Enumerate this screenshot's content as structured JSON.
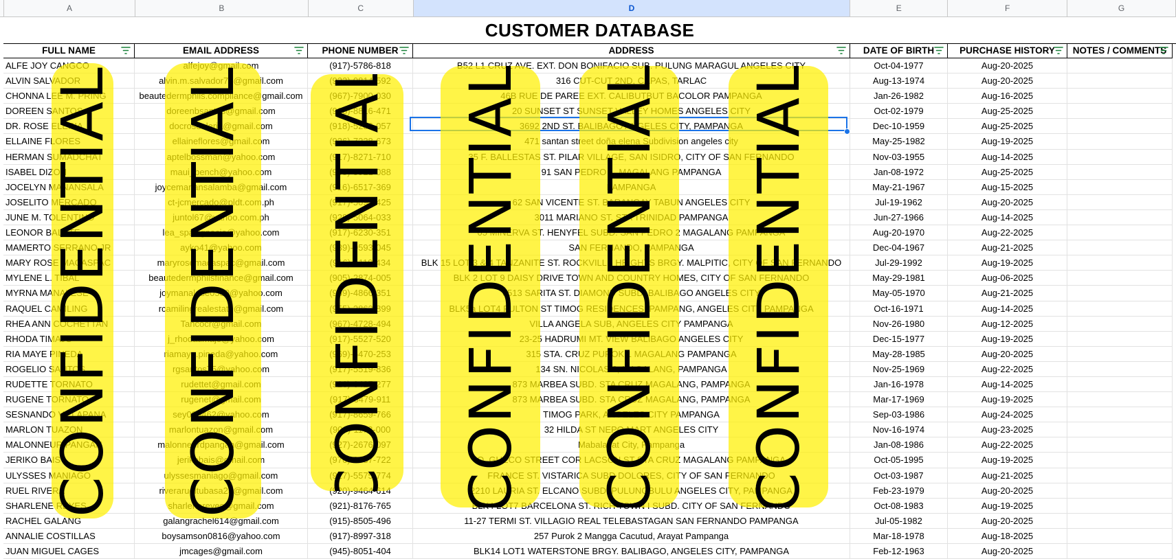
{
  "sheet": {
    "column_letters": [
      "A",
      "B",
      "C",
      "D",
      "E",
      "F",
      "G"
    ],
    "selected_column": "D",
    "title": "CUSTOMER DATABASE",
    "headers": [
      "FULL NAME",
      "EMAIL ADDRESS",
      "PHONE NUMBER",
      "ADDRESS",
      "DATE OF BIRTH",
      "PURCHASE HISTORY",
      "NOTES / COMMENTS"
    ],
    "filter_icon": "filter-icon",
    "rows": [
      [
        "ALFE JOY CANGCO",
        "alfejoy@gmail.com",
        "(917)-5786-818",
        "B52 L1 CRUZ AVE. EXT. DON BONIFACIO SUB. PULUNG MARAGUL ANGELES CITY",
        "Oct-04-1977",
        "Aug-20-2025",
        ""
      ],
      [
        "ALVIN SALVADOR",
        "alvin.m.salvador74@gmail.com",
        "(923)-0814-592",
        "316 CUT-CUT 2ND, CAPAS, TARLAC",
        "Aug-13-1974",
        "Aug-20-2025",
        ""
      ],
      [
        "CHONNA LEE M. PRING",
        "beautedermphils.compliance@gmail.com",
        "(967)-7900-030",
        "46B RUE DE PAREE EXT. CALIBUTBUT BACOLOR PAMPANGA",
        "Jan-26-1982",
        "Aug-16-2025",
        ""
      ],
      [
        "DOREEN SANTOS",
        "doreenbsantos@gmail.com",
        "(968)-8816-471",
        "20 SUNSET ST SUNSET VALLEY HOMES ANGELES CITY",
        "Oct-02-1979",
        "Aug-25-2025",
        ""
      ],
      [
        "DR. ROSE ELERIA",
        "docroseeleria@gmail.com",
        "(918)-5286-057",
        "3692 2ND ST. BALIBAGO ANGELES CITY, PAMPANGA",
        "Dec-10-1959",
        "Aug-25-2025",
        ""
      ],
      [
        "ELLAINE FLORES",
        "ellaineflores@gmail.com",
        "(926)-7238-673",
        "471 santan street doña elena Subdivision angeles city",
        "May-25-1982",
        "Aug-19-2025",
        ""
      ],
      [
        "HERMAN SUMADCHAT",
        "aptelbossman@yahoo.com",
        "(917)-8271-710",
        "35 F. BALLESTAS ST. PILAR VILLAGE, SAN ISIDRO, CITY OF SAN FERNANDO",
        "Nov-03-1955",
        "Aug-14-2025",
        ""
      ],
      [
        "ISABEL DIZON",
        "maui_bench@yahoo.com",
        "(905)-5921-088",
        "91 SAN PEDRO 1, MAGALANG PAMPANGA",
        "Jan-08-1972",
        "Aug-25-2025",
        ""
      ],
      [
        "JOCELYN MANANSALA",
        "joycemanansalamba@gmail.com",
        "(916)-6517-369",
        "PAMPANGA",
        "May-21-1967",
        "Aug-15-2025",
        ""
      ],
      [
        "JOSELITO MERCADO",
        "ct-jcmercado@pldt.com.ph",
        "(917)-5094-425",
        "62 SAN VICENTE ST. BARANGAY TABUN ANGELES CITY",
        "Jul-19-1962",
        "Aug-20-2025",
        ""
      ],
      [
        "JUNE M. TOLENTINO",
        "juntol67@yahoo.com.ph",
        "(928)-5064-033",
        "3011 MARIANO ST. STA TRINIDAD PAMPANGA",
        "Jun-27-1966",
        "Aug-14-2025",
        ""
      ],
      [
        "LEONOR BALETE",
        "lea_spasignacio@yahoo.com",
        "(917)-6230-351",
        "05 MINERVA ST. HENYFEL SUBD. SAN PEDRO 2 MAGALANG PAMPANGA",
        "Aug-20-1970",
        "Aug-22-2025",
        ""
      ],
      [
        "MAMERTO SERRANO JR",
        "ayko41@yahoo.com",
        "(939)-9593-045",
        "SAN FERNANDO, PAMPANGA",
        "Dec-04-1967",
        "Aug-21-2025",
        ""
      ],
      [
        "MARY ROSE MACASPAC",
        "maryrosemacaspac@gmail.com",
        "(916)-4118-434",
        "BLK 15 LOT 3 & 4 TANZANITE ST. ROCKVILLE HEIGHTS BRGY. MALPITIC, CITY OF SAN FERNANDO",
        "Jul-29-1992",
        "Aug-19-2025",
        ""
      ],
      [
        "MYLENE L. TIBAL",
        "beautedermphilsfinance@gmail.com",
        "(905)-2874-005",
        "BLK 2 LOT 9 DAISY DRIVE TOWN AND COUNTRY HOMES, CITY OF SAN FERNANDO",
        "May-29-1981",
        "Aug-06-2025",
        ""
      ],
      [
        "MYRNA MANALESE",
        "joymanalese0580@yahoo.com",
        "(969)-4866-351",
        "6513 SARITA ST. DIAMOND SUBD. BALIBAGO ANGELES CITY",
        "May-05-1970",
        "Aug-21-2025",
        ""
      ],
      [
        "RAQUEL CAMILING",
        "rcamilingrealestate@gmail.com",
        "(955)-3862-899",
        "BLK5a LOT4 FULTON ST TIMOG RESIDENCES, PAMPANG, ANGELES CITY PAMPANGA",
        "Oct-16-1971",
        "Aug-14-2025",
        ""
      ],
      [
        "RHEA ANN COCHETTAN",
        "Tancocr@gmail.com",
        "(967)-4728-494",
        "VILLA ANGELA SUB, ANGELES CITY PAMPANGA",
        "Nov-26-1980",
        "Aug-12-2025",
        ""
      ],
      [
        "RHODA TIMAJO",
        "j_rhodatimajo@yahoo.com",
        "(917)-5527-520",
        "23-25 HADRUMI MT. VIEW BALIBAGO ANGELES CITY",
        "Dec-15-1977",
        "Aug-19-2025",
        ""
      ],
      [
        "RIA MAYE PINEDA",
        "riamaye.pineda@yahoo.com",
        "(969)-6470-253",
        "315 STA. CRUZ PUROK 1 MAGALANG PAMPANGA",
        "May-28-1985",
        "Aug-20-2025",
        ""
      ],
      [
        "ROGELIO SANTOS",
        "rgsantos75@yahoo.com",
        "(917)-5519-836",
        "134 SN. NICOLAS 2, MAGALANG, PAMPANGA",
        "Nov-25-1969",
        "Aug-22-2025",
        ""
      ],
      [
        "RUDETTE TORNATO",
        "rudettet@gmail.com",
        "(926)-6427-277",
        "873 MARBEA SUBD. STA CRUZ MAGALANG, PAMPANGA",
        "Jan-16-1978",
        "Aug-14-2025",
        ""
      ],
      [
        "RUGENE TORNATO",
        "rugenet@gmail.com",
        "(917)-6479-911",
        "873 MARBEA SUBD. STA CRUZ MAGALANG, PAMPANGA",
        "Mar-17-1969",
        "Aug-19-2025",
        ""
      ],
      [
        "SESNANDO VILLAPANA",
        "sey090462@yahoo.com",
        "(917)-8659-766",
        "TIMOG PARK, ANGELES CITY PAMPANGA",
        "Sep-03-1986",
        "Aug-24-2025",
        ""
      ],
      [
        "MARLON TUAZON",
        "marlontuazon@gmail.com",
        "(906)-1173-000",
        "32 HILDA ST NEPO MART ANGELES CITY",
        "Nov-16-1974",
        "Aug-23-2025",
        ""
      ],
      [
        "MALONNEUR PANGAN",
        "malonneurdpangan@gmail.com",
        "(927)-2676-097",
        "Mabalacat City, Pampanga",
        "Jan-08-1986",
        "Aug-22-2025",
        ""
      ],
      [
        "JERIKO BAIS",
        "jerikobais@gmail.com",
        "(976)-2637-722",
        "O. GUECO STREET COR LACSON ST STA CRUZ MAGALANG PAMPANGA",
        "Oct-05-1995",
        "Aug-19-2025",
        ""
      ],
      [
        "ULYSSES MANIAGO",
        "ulyssesmaniago@gmail.com",
        "(917)-5575-774",
        "FRANCE ST. VISTARICA SUBD DOLORES, CITY OF SAN FERNANDO",
        "Oct-03-1987",
        "Aug-21-2025",
        ""
      ],
      [
        "RUEL RIVERA",
        "riverarueltubasa23@gmail.com",
        "(920)-9464-614",
        "2210 LAURIA ST. ELCANO SUBD. PULUNGBULU ANGELES CITY, PAMPANGA",
        "Feb-23-1979",
        "Aug-20-2025",
        ""
      ],
      [
        "SHARLENE REYES",
        "sharlenereyes@gmail.com",
        "(921)-8176-765",
        "BLK4 LOT7 BARCELONA ST. RICH TOWN I SUBD. CITY OF SAN FERNANDO",
        "Oct-08-1983",
        "Aug-19-2025",
        ""
      ],
      [
        "RACHEL GALANG",
        "galangrachel614@gmail.com",
        "(915)-8505-496",
        "11-27 TERMI ST. VILLAGIO REAL TELEBASTAGAN SAN FERNANDO PAMPANGA",
        "Jul-05-1982",
        "Aug-20-2025",
        ""
      ],
      [
        "ANNALIE COSTILLAS",
        "boysamson0816@yahoo.com",
        "(917)-8997-318",
        "257 Purok 2 Mangga Cacutud, Arayat Pampanga",
        "Mar-18-1978",
        "Aug-18-2025",
        ""
      ],
      [
        "JUAN MIGUEL CAGES",
        "jmcages@gmail.com",
        "(945)-8051-404",
        "BLK14 LOT1 WATERSTONE BRGY. BALIBAGO, ANGELES CITY, PAMPANGA",
        "Feb-12-1963",
        "Aug-20-2025",
        ""
      ]
    ]
  },
  "overlay": {
    "label": "CONFIDENTIAL",
    "color": "#fff200"
  }
}
